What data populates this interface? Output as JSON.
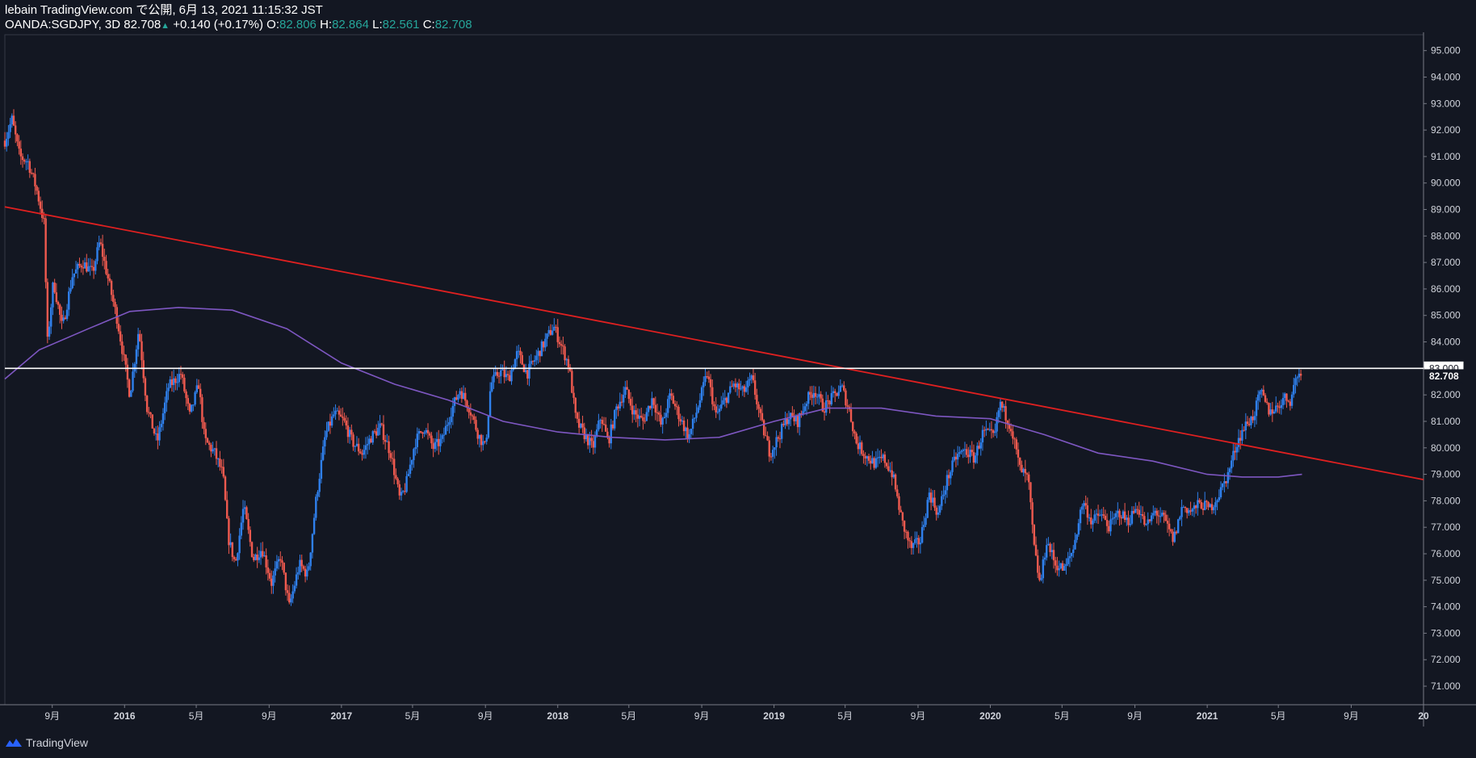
{
  "header": {
    "published": "lebain TradingView.com で公開, 6月 13, 2021 11:15:32 JST",
    "symbol_interval": "OANDA:SGDJPY, 3D",
    "last": "82.708",
    "change": "+0.140 (+0.17%)",
    "open_label": "O:",
    "open": "82.806",
    "high_label": "H:",
    "high": "82.864",
    "low_label": "L:",
    "low": "82.561",
    "close_label": "C:",
    "close": "82.708"
  },
  "footer": {
    "brand": "TradingView"
  },
  "colors": {
    "background": "#131722",
    "up": "#2f80ed",
    "down": "#f05a4f",
    "ma": "#7e57c2",
    "trendline": "#e02020",
    "hline": "#ffffff",
    "text": "#d1d4dc",
    "grid": "#2a2e39"
  },
  "chart_data": {
    "type": "candlestick",
    "symbol": "OANDA:SGDJPY",
    "interval": "3D",
    "ylim": [
      70.3,
      95.6
    ],
    "y_ticks": [
      "95.000",
      "94.000",
      "93.000",
      "92.000",
      "91.000",
      "90.000",
      "89.000",
      "88.000",
      "87.000",
      "86.000",
      "85.000",
      "84.000",
      "83.000",
      "82.000",
      "81.000",
      "80.000",
      "79.000",
      "78.000",
      "77.000",
      "76.000",
      "75.000",
      "74.000",
      "73.000",
      "72.000",
      "71.000"
    ],
    "x_ticks": [
      {
        "label": "9月",
        "date": "2015-09-01"
      },
      {
        "label": "2016",
        "date": "2016-01-01"
      },
      {
        "label": "5月",
        "date": "2016-05-01"
      },
      {
        "label": "9月",
        "date": "2016-09-01"
      },
      {
        "label": "2017",
        "date": "2017-01-01"
      },
      {
        "label": "5月",
        "date": "2017-05-01"
      },
      {
        "label": "9月",
        "date": "2017-09-01"
      },
      {
        "label": "2018",
        "date": "2018-01-01"
      },
      {
        "label": "5月",
        "date": "2018-05-01"
      },
      {
        "label": "9月",
        "date": "2018-09-01"
      },
      {
        "label": "2019",
        "date": "2019-01-01"
      },
      {
        "label": "5月",
        "date": "2019-05-01"
      },
      {
        "label": "9月",
        "date": "2019-09-01"
      },
      {
        "label": "2020",
        "date": "2020-01-01"
      },
      {
        "label": "5月",
        "date": "2020-05-01"
      },
      {
        "label": "9月",
        "date": "2020-09-01"
      },
      {
        "label": "2021",
        "date": "2021-01-01"
      },
      {
        "label": "5月",
        "date": "2021-05-01"
      },
      {
        "label": "9月",
        "date": "2021-09-01"
      },
      {
        "label": "20",
        "date": "2022-01-01"
      }
    ],
    "x_range": [
      "2015-06-13",
      "2022-01-01"
    ],
    "price_path": [
      [
        "2015-06-13",
        91.6
      ],
      [
        "2015-06-25",
        92.4
      ],
      [
        "2015-07-08",
        91.0
      ],
      [
        "2015-07-22",
        90.8
      ],
      [
        "2015-08-05",
        89.8
      ],
      [
        "2015-08-18",
        88.5
      ],
      [
        "2015-08-24",
        84.0
      ],
      [
        "2015-09-03",
        86.3
      ],
      [
        "2015-09-18",
        84.5
      ],
      [
        "2015-10-05",
        86.5
      ],
      [
        "2015-10-22",
        87.0
      ],
      [
        "2015-11-08",
        86.6
      ],
      [
        "2015-11-20",
        87.8
      ],
      [
        "2015-12-03",
        86.5
      ],
      [
        "2015-12-20",
        84.8
      ],
      [
        "2016-01-10",
        82.0
      ],
      [
        "2016-01-25",
        84.5
      ],
      [
        "2016-02-08",
        81.5
      ],
      [
        "2016-02-25",
        80.2
      ],
      [
        "2016-03-15",
        82.3
      ],
      [
        "2016-04-05",
        82.8
      ],
      [
        "2016-04-20",
        81.2
      ],
      [
        "2016-05-05",
        82.4
      ],
      [
        "2016-05-15",
        80.3
      ],
      [
        "2016-06-01",
        79.8
      ],
      [
        "2016-06-15",
        79.0
      ],
      [
        "2016-06-24",
        76.6
      ],
      [
        "2016-07-06",
        75.6
      ],
      [
        "2016-07-20",
        77.8
      ],
      [
        "2016-08-05",
        75.8
      ],
      [
        "2016-08-20",
        76.2
      ],
      [
        "2016-09-05",
        74.9
      ],
      [
        "2016-09-20",
        75.9
      ],
      [
        "2016-10-05",
        74.0
      ],
      [
        "2016-10-22",
        75.6
      ],
      [
        "2016-11-05",
        75.2
      ],
      [
        "2016-11-20",
        78.2
      ],
      [
        "2016-12-05",
        80.5
      ],
      [
        "2016-12-20",
        81.3
      ],
      [
        "2017-01-05",
        81.0
      ],
      [
        "2017-01-20",
        80.2
      ],
      [
        "2017-02-05",
        79.8
      ],
      [
        "2017-02-20",
        80.4
      ],
      [
        "2017-03-08",
        80.8
      ],
      [
        "2017-03-25",
        79.8
      ],
      [
        "2017-04-10",
        78.0
      ],
      [
        "2017-04-20",
        78.6
      ],
      [
        "2017-05-05",
        80.2
      ],
      [
        "2017-05-20",
        80.8
      ],
      [
        "2017-06-05",
        80.0
      ],
      [
        "2017-06-20",
        80.3
      ],
      [
        "2017-07-05",
        81.4
      ],
      [
        "2017-07-20",
        82.2
      ],
      [
        "2017-08-05",
        81.5
      ],
      [
        "2017-08-20",
        80.5
      ],
      [
        "2017-09-01",
        80.0
      ],
      [
        "2017-09-10",
        82.4
      ],
      [
        "2017-09-25",
        82.9
      ],
      [
        "2017-10-10",
        82.6
      ],
      [
        "2017-10-25",
        83.6
      ],
      [
        "2017-11-10",
        82.8
      ],
      [
        "2017-11-25",
        83.4
      ],
      [
        "2017-12-10",
        84.0
      ],
      [
        "2017-12-25",
        84.6
      ],
      [
        "2018-01-08",
        83.8
      ],
      [
        "2018-01-20",
        83.1
      ],
      [
        "2018-02-01",
        81.0
      ],
      [
        "2018-02-15",
        80.5
      ],
      [
        "2018-03-01",
        80.0
      ],
      [
        "2018-03-15",
        81.2
      ],
      [
        "2018-03-27",
        80.2
      ],
      [
        "2018-04-10",
        81.5
      ],
      [
        "2018-04-25",
        82.2
      ],
      [
        "2018-05-10",
        81.3
      ],
      [
        "2018-05-25",
        81.0
      ],
      [
        "2018-06-10",
        81.9
      ],
      [
        "2018-06-25",
        80.8
      ],
      [
        "2018-07-10",
        82.0
      ],
      [
        "2018-07-25",
        81.2
      ],
      [
        "2018-08-10",
        80.4
      ],
      [
        "2018-08-25",
        81.5
      ],
      [
        "2018-09-10",
        82.8
      ],
      [
        "2018-09-25",
        81.2
      ],
      [
        "2018-10-10",
        81.8
      ],
      [
        "2018-10-25",
        82.4
      ],
      [
        "2018-11-10",
        82.1
      ],
      [
        "2018-11-25",
        82.6
      ],
      [
        "2018-12-10",
        81.0
      ],
      [
        "2018-12-25",
        79.8
      ],
      [
        "2019-01-08",
        80.4
      ],
      [
        "2019-01-25",
        81.2
      ],
      [
        "2019-02-10",
        81.0
      ],
      [
        "2019-02-25",
        81.8
      ],
      [
        "2019-03-10",
        82.2
      ],
      [
        "2019-03-25",
        81.5
      ],
      [
        "2019-04-10",
        81.9
      ],
      [
        "2019-04-25",
        82.3
      ],
      [
        "2019-05-08",
        81.4
      ],
      [
        "2019-05-20",
        80.2
      ],
      [
        "2019-06-05",
        79.7
      ],
      [
        "2019-06-20",
        79.4
      ],
      [
        "2019-07-05",
        79.6
      ],
      [
        "2019-07-20",
        79.0
      ],
      [
        "2019-08-05",
        77.2
      ],
      [
        "2019-08-20",
        76.2
      ],
      [
        "2019-09-05",
        76.5
      ],
      [
        "2019-09-20",
        78.3
      ],
      [
        "2019-10-05",
        77.5
      ],
      [
        "2019-10-20",
        78.8
      ],
      [
        "2019-11-05",
        79.7
      ],
      [
        "2019-11-20",
        79.9
      ],
      [
        "2019-12-05",
        79.6
      ],
      [
        "2019-12-20",
        80.6
      ],
      [
        "2020-01-08",
        80.4
      ],
      [
        "2020-01-17",
        81.7
      ],
      [
        "2020-02-05",
        80.8
      ],
      [
        "2020-02-20",
        79.2
      ],
      [
        "2020-03-05",
        78.8
      ],
      [
        "2020-03-15",
        76.2
      ],
      [
        "2020-03-25",
        74.8
      ],
      [
        "2020-04-05",
        76.5
      ],
      [
        "2020-04-20",
        75.6
      ],
      [
        "2020-05-05",
        75.4
      ],
      [
        "2020-05-20",
        76.2
      ],
      [
        "2020-06-05",
        78.0
      ],
      [
        "2020-06-20",
        77.2
      ],
      [
        "2020-07-05",
        77.5
      ],
      [
        "2020-07-20",
        77.0
      ],
      [
        "2020-08-05",
        77.6
      ],
      [
        "2020-08-20",
        77.2
      ],
      [
        "2020-09-05",
        77.8
      ],
      [
        "2020-09-20",
        77.0
      ],
      [
        "2020-10-05",
        77.6
      ],
      [
        "2020-10-20",
        77.3
      ],
      [
        "2020-11-05",
        76.5
      ],
      [
        "2020-11-20",
        77.8
      ],
      [
        "2020-12-05",
        77.6
      ],
      [
        "2020-12-20",
        77.9
      ],
      [
        "2021-01-05",
        77.7
      ],
      [
        "2021-01-20",
        78.2
      ],
      [
        "2021-02-05",
        79.0
      ],
      [
        "2021-02-20",
        80.2
      ],
      [
        "2021-03-05",
        80.8
      ],
      [
        "2021-03-20",
        81.2
      ],
      [
        "2021-04-01",
        82.1
      ],
      [
        "2021-04-15",
        81.4
      ],
      [
        "2021-04-28",
        81.5
      ],
      [
        "2021-05-10",
        81.9
      ],
      [
        "2021-05-22",
        81.8
      ],
      [
        "2021-06-01",
        82.8
      ],
      [
        "2021-06-10",
        82.7
      ]
    ],
    "moving_average": [
      [
        "2015-06-13",
        82.6
      ],
      [
        "2015-08-10",
        83.7
      ],
      [
        "2015-11-01",
        84.5
      ],
      [
        "2016-01-10",
        85.15
      ],
      [
        "2016-04-01",
        85.3
      ],
      [
        "2016-07-01",
        85.2
      ],
      [
        "2016-10-01",
        84.5
      ],
      [
        "2017-01-01",
        83.2
      ],
      [
        "2017-04-01",
        82.4
      ],
      [
        "2017-07-01",
        81.8
      ],
      [
        "2017-10-01",
        81.0
      ],
      [
        "2018-01-01",
        80.6
      ],
      [
        "2018-04-01",
        80.4
      ],
      [
        "2018-07-01",
        80.3
      ],
      [
        "2018-10-01",
        80.4
      ],
      [
        "2019-01-01",
        81.0
      ],
      [
        "2019-04-01",
        81.5
      ],
      [
        "2019-07-01",
        81.5
      ],
      [
        "2019-10-01",
        81.2
      ],
      [
        "2020-01-01",
        81.1
      ],
      [
        "2020-04-01",
        80.5
      ],
      [
        "2020-07-01",
        79.8
      ],
      [
        "2020-10-01",
        79.5
      ],
      [
        "2021-01-01",
        79.0
      ],
      [
        "2021-03-01",
        78.9
      ],
      [
        "2021-05-01",
        78.9
      ],
      [
        "2021-06-10",
        79.0
      ]
    ],
    "trendline": {
      "start": [
        "2015-06-13",
        89.1
      ],
      "end": [
        "2022-01-01",
        78.8
      ]
    },
    "horizontal_line": 83.0,
    "price_labels": [
      {
        "text": "83.000",
        "value": 83.0,
        "style": "white"
      },
      {
        "text": "82.708",
        "value": 82.708,
        "style": "dark"
      }
    ]
  }
}
